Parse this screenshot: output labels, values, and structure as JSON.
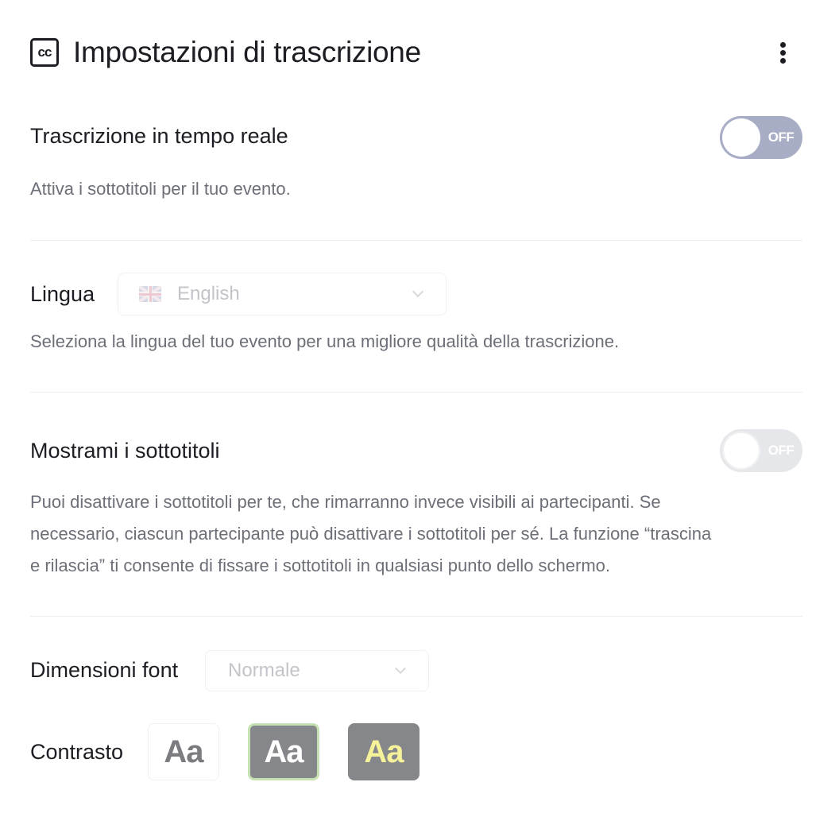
{
  "header": {
    "icon": "closed-captions-icon",
    "icon_glyph": "cc",
    "title": "Impostazioni di trascrizione",
    "more_icon": "more-vertical-icon"
  },
  "live_transcription": {
    "label": "Trascrizione in tempo reale",
    "toggle_state": "OFF",
    "description": "Attiva i sottotitoli per il tuo evento."
  },
  "language": {
    "label": "Lingua",
    "selected": "English",
    "flag_icon": "uk-flag-icon",
    "description": "Seleziona la lingua del tuo evento per una migliore qualità della trascrizione."
  },
  "show_captions": {
    "label": "Mostrami i sottotitoli",
    "toggle_state": "OFF",
    "description_lines": [
      "Puoi disattivare i sottotitoli per te, che rimarranno invece visibili ai partecipanti. Se",
      "necessario, ciascun partecipante può disattivare i sottotitoli per sé. La funzione “trascina",
      "e rilascia” ti consente di fissare i sottotitoli in qualsiasi punto dello schermo."
    ]
  },
  "font_size": {
    "label": "Dimensioni font",
    "selected": "Normale"
  },
  "contrast": {
    "label": "Contrasto",
    "options": [
      {
        "text": "Aa",
        "style": "light",
        "selected": false,
        "text_color": "#7c7c80",
        "bg_color": "#ffffff"
      },
      {
        "text": "Aa",
        "style": "dark",
        "selected": true,
        "text_color": "#ffffff",
        "bg_color": "#86878a"
      },
      {
        "text": "Aa",
        "style": "yellow",
        "selected": false,
        "text_color": "#f5f29a",
        "bg_color": "#86878a"
      }
    ]
  },
  "colors": {
    "toggle_off_active": "#a8adc6",
    "toggle_off_disabled": "#e6e7ea",
    "selected_outline": "#c6e2b3"
  }
}
